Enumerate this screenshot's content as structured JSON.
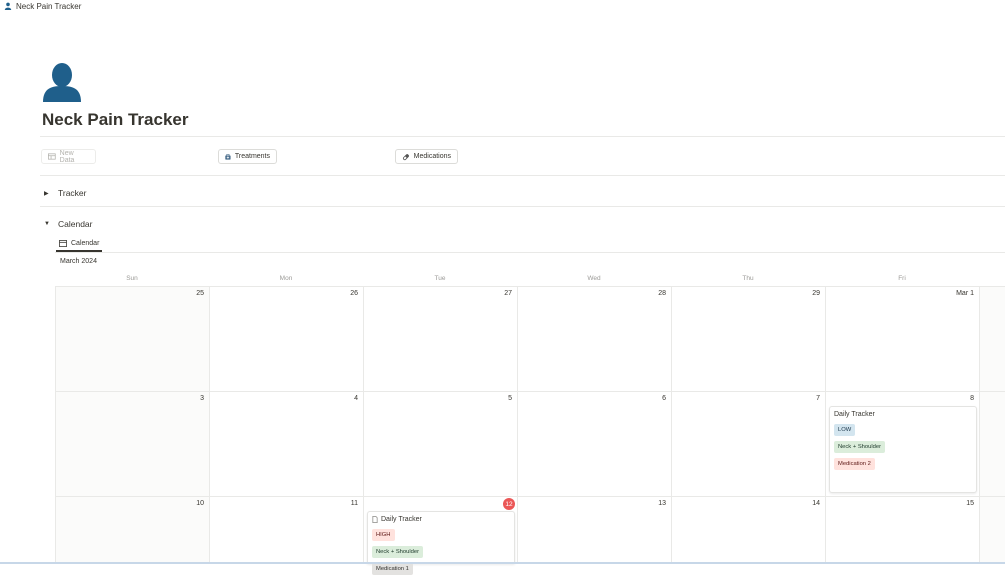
{
  "breadcrumb": {
    "title": "Neck Pain Tracker"
  },
  "page": {
    "title": "Neck Pain Tracker",
    "icon": "person-icon"
  },
  "buttons": [
    {
      "label": "New Data",
      "icon": "table-icon",
      "disabled": true
    },
    {
      "label": "Treatments",
      "icon": "medical-bag-icon",
      "disabled": false
    },
    {
      "label": "Medications",
      "icon": "pill-icon",
      "disabled": false
    }
  ],
  "sections": {
    "tracker": {
      "label": "Tracker",
      "expanded": false
    },
    "calendar": {
      "label": "Calendar",
      "expanded": true
    }
  },
  "calendar": {
    "view_tab": "Calendar",
    "month_label": "March 2024",
    "weekdays": [
      "Sun",
      "Mon",
      "Tue",
      "Wed",
      "Thu",
      "Fri"
    ],
    "weeks": [
      [
        "25",
        "26",
        "27",
        "28",
        "29",
        "Mar 1"
      ],
      [
        "3",
        "4",
        "5",
        "6",
        "7",
        "8"
      ],
      [
        "10",
        "11",
        "12",
        "13",
        "14",
        "15"
      ]
    ],
    "today": "12",
    "events": [
      {
        "title": "Daily Tracker",
        "pain_level": "LOW",
        "area": "Neck + Shoulder",
        "medication": "Medication 2"
      },
      {
        "title": "Daily Tracker",
        "pain_level": "HIGH",
        "area": "Neck + Shoulder",
        "medication": "Medication 1"
      }
    ]
  },
  "colors": {
    "tag_low_bg": "#d3e5ef",
    "tag_low_fg": "#183347",
    "tag_high_bg": "#ffe2dd",
    "tag_high_fg": "#5d1715",
    "tag_area_bg": "#dbeddb",
    "tag_area_fg": "#1c3829",
    "tag_med2_bg": "#ffe2dd",
    "tag_med2_fg": "#5d1715",
    "tag_med1_bg": "#e3e2e0",
    "tag_med1_fg": "#32302c",
    "today_badge": "#eb5757"
  }
}
